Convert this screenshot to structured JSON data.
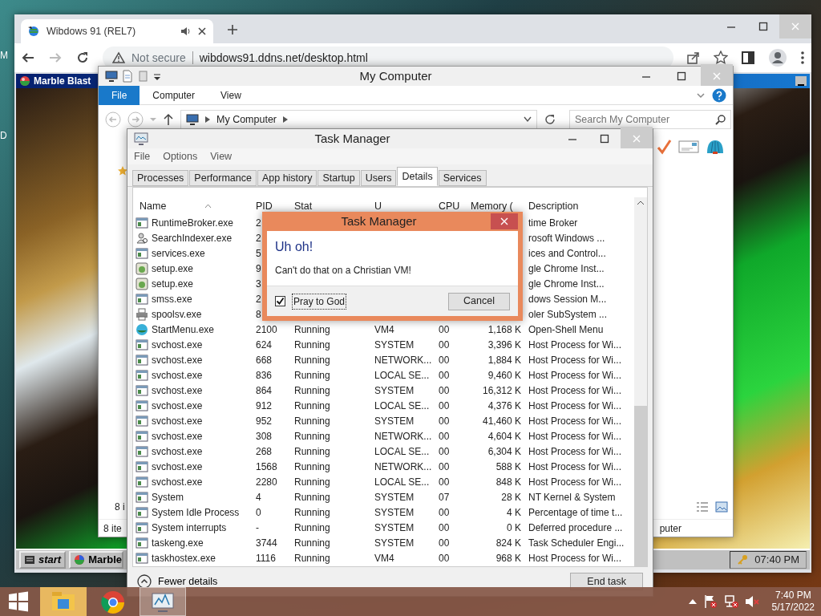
{
  "desktop": {
    "edge_labels": [
      "M",
      "D"
    ]
  },
  "browser": {
    "tab": {
      "title": "Wibdows 91 (REL7)"
    },
    "security": "Not secure",
    "url": "wibdows91.ddns.net/desktop.html"
  },
  "game_window": {
    "title": "Marble Blast"
  },
  "emulated_taskbar": {
    "start": "start",
    "tasks": [
      {
        "label": "Marble"
      }
    ],
    "clock": "07:40 PM"
  },
  "explorer": {
    "title": "My Computer",
    "ribbon_tabs": [
      {
        "label": "File",
        "selected": true
      },
      {
        "label": "Computer",
        "selected": false
      },
      {
        "label": "View",
        "selected": false
      }
    ],
    "address": "My Computer",
    "search": {
      "placeholder": "Search My Computer"
    },
    "pane_text": "8 i",
    "status_left": "8 ite",
    "status_right": "puter"
  },
  "task_manager": {
    "title": "Task Manager",
    "menu": [
      "File",
      "Options",
      "View"
    ],
    "tabs": [
      {
        "label": "Processes",
        "selected": false
      },
      {
        "label": "Performance",
        "selected": false
      },
      {
        "label": "App history",
        "selected": false
      },
      {
        "label": "Startup",
        "selected": false
      },
      {
        "label": "Users",
        "selected": false
      },
      {
        "label": "Details",
        "selected": true
      },
      {
        "label": "Services",
        "selected": false
      }
    ],
    "columns": [
      "Name",
      "PID",
      "Stat",
      "U",
      "CPU",
      "Memory (",
      "Description"
    ],
    "rows": [
      {
        "kind": "window",
        "name": "RuntimeBroker.exe",
        "pid": "2",
        "description": "time Broker"
      },
      {
        "kind": "search",
        "name": "SearchIndexer.exe",
        "pid": "2",
        "description": "rosoft Windows ..."
      },
      {
        "kind": "window",
        "name": "services.exe",
        "pid": "5",
        "description": "ices and Control..."
      },
      {
        "kind": "installer",
        "name": "setup.exe",
        "pid": "9",
        "description": "gle Chrome Inst..."
      },
      {
        "kind": "installer",
        "name": "setup.exe",
        "pid": "3",
        "description": "gle Chrome Inst..."
      },
      {
        "kind": "window",
        "name": "smss.exe",
        "pid": "2",
        "description": "dows Session M..."
      },
      {
        "kind": "printer",
        "name": "spoolsv.exe",
        "pid": "8",
        "description": "oler SubSystem ..."
      },
      {
        "kind": "sphere",
        "name": "StartMenu.exe",
        "pid": "2100",
        "status": "Running",
        "user": "VM4",
        "cpu": "00",
        "memory": "1,168 K",
        "description": "Open-Shell Menu"
      },
      {
        "kind": "window",
        "name": "svchost.exe",
        "pid": "624",
        "status": "Running",
        "user": "SYSTEM",
        "cpu": "00",
        "memory": "3,396 K",
        "description": "Host Process for Wi..."
      },
      {
        "kind": "window",
        "name": "svchost.exe",
        "pid": "668",
        "status": "Running",
        "user": "NETWORK...",
        "cpu": "00",
        "memory": "1,884 K",
        "description": "Host Process for Wi..."
      },
      {
        "kind": "window",
        "name": "svchost.exe",
        "pid": "836",
        "status": "Running",
        "user": "LOCAL SE...",
        "cpu": "00",
        "memory": "9,460 K",
        "description": "Host Process for Wi..."
      },
      {
        "kind": "window",
        "name": "svchost.exe",
        "pid": "864",
        "status": "Running",
        "user": "SYSTEM",
        "cpu": "00",
        "memory": "16,312 K",
        "description": "Host Process for Wi..."
      },
      {
        "kind": "window",
        "name": "svchost.exe",
        "pid": "912",
        "status": "Running",
        "user": "LOCAL SE...",
        "cpu": "00",
        "memory": "4,376 K",
        "description": "Host Process for Wi..."
      },
      {
        "kind": "window",
        "name": "svchost.exe",
        "pid": "952",
        "status": "Running",
        "user": "SYSTEM",
        "cpu": "00",
        "memory": "41,460 K",
        "description": "Host Process for Wi..."
      },
      {
        "kind": "window",
        "name": "svchost.exe",
        "pid": "308",
        "status": "Running",
        "user": "NETWORK...",
        "cpu": "00",
        "memory": "4,604 K",
        "description": "Host Process for Wi..."
      },
      {
        "kind": "window",
        "name": "svchost.exe",
        "pid": "268",
        "status": "Running",
        "user": "LOCAL SE...",
        "cpu": "00",
        "memory": "6,304 K",
        "description": "Host Process for Wi..."
      },
      {
        "kind": "window",
        "name": "svchost.exe",
        "pid": "1568",
        "status": "Running",
        "user": "NETWORK...",
        "cpu": "00",
        "memory": "588 K",
        "description": "Host Process for Wi..."
      },
      {
        "kind": "window",
        "name": "svchost.exe",
        "pid": "2280",
        "status": "Running",
        "user": "LOCAL SE...",
        "cpu": "00",
        "memory": "848 K",
        "description": "Host Process for Wi..."
      },
      {
        "kind": "window",
        "name": "System",
        "pid": "4",
        "status": "Running",
        "user": "SYSTEM",
        "cpu": "07",
        "memory": "28 K",
        "description": "NT Kernel & System"
      },
      {
        "kind": "window",
        "name": "System Idle Process",
        "pid": "0",
        "status": "Running",
        "user": "SYSTEM",
        "cpu": "00",
        "memory": "4 K",
        "description": "Percentage of time t..."
      },
      {
        "kind": "window",
        "name": "System interrupts",
        "pid": "-",
        "status": "Running",
        "user": "SYSTEM",
        "cpu": "00",
        "memory": "0 K",
        "description": "Deferred procedure ..."
      },
      {
        "kind": "window",
        "name": "taskeng.exe",
        "pid": "3744",
        "status": "Running",
        "user": "SYSTEM",
        "cpu": "00",
        "memory": "824 K",
        "description": "Task Scheduler Engi..."
      },
      {
        "kind": "window",
        "name": "taskhostex.exe",
        "pid": "1116",
        "status": "Running",
        "user": "VM4",
        "cpu": "00",
        "memory": "968 K",
        "description": "Host Process for Wi..."
      }
    ],
    "fewer_details": "Fewer details",
    "end_task": "End task"
  },
  "dialog": {
    "title": "Task Manager",
    "heading": "Uh oh!",
    "message": "Can't do that on a Christian VM!",
    "checkbox": {
      "label": "Pray to God",
      "checked": true
    },
    "button": "Cancel"
  },
  "taskbar": {
    "pinned": [
      {
        "kind": "explorer",
        "selected": false
      },
      {
        "kind": "chrome",
        "selected": false
      },
      {
        "kind": "taskmgr",
        "selected": true
      }
    ],
    "time": "7:40 PM",
    "date": "5/17/2022"
  }
}
